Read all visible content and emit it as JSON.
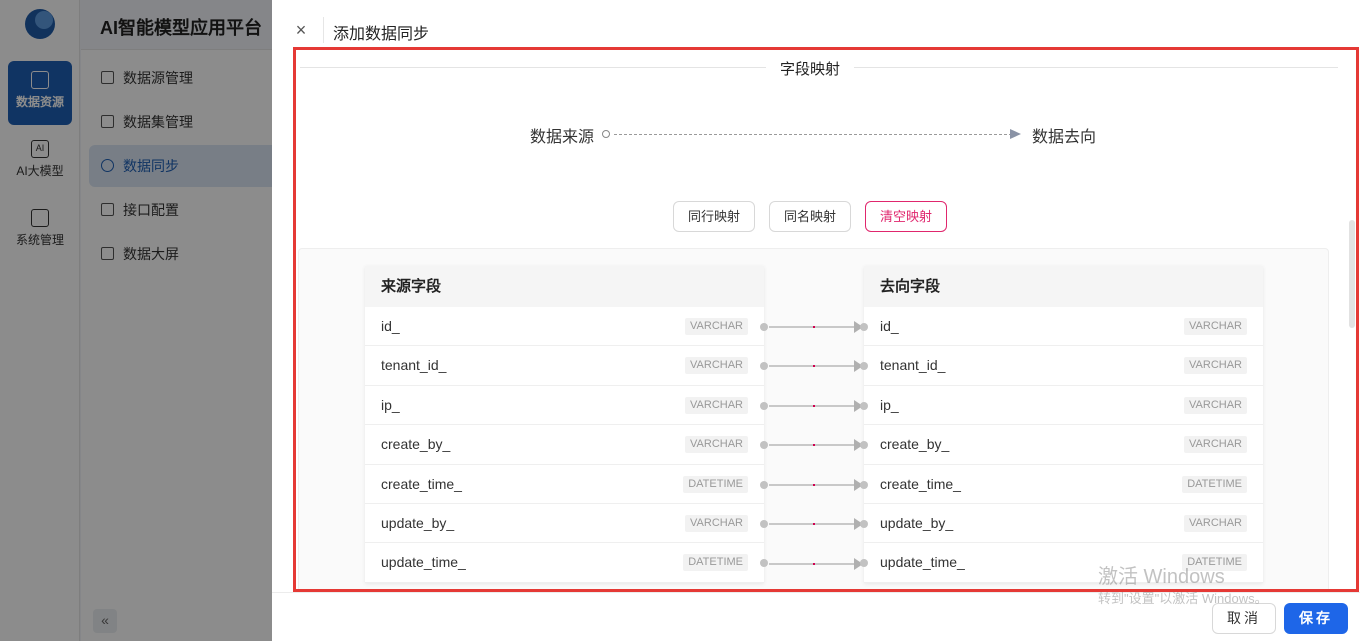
{
  "app": {
    "brand": "AI智能模型应用平台",
    "rail": [
      {
        "label": "数据资源",
        "active": true
      },
      {
        "label": "AI大模型",
        "active": false
      },
      {
        "label": "系统管理",
        "active": false
      }
    ],
    "subnav": [
      {
        "label": "数据源管理",
        "icon": "database-icon",
        "active": false
      },
      {
        "label": "数据集管理",
        "icon": "list-icon",
        "active": false
      },
      {
        "label": "数据同步",
        "icon": "sync-icon",
        "active": true
      },
      {
        "label": "接口配置",
        "icon": "plug-icon",
        "active": false
      },
      {
        "label": "数据大屏",
        "icon": "monitor-icon",
        "active": false
      }
    ],
    "collapse_label": "«"
  },
  "drawer": {
    "close_label": "×",
    "title": "添加数据同步",
    "section_title": "字段映射",
    "flow": {
      "source": "数据来源",
      "target": "数据去向"
    },
    "actions": {
      "row_map": "同行映射",
      "name_map": "同名映射",
      "clear_map": "清空映射"
    },
    "source_table": {
      "header": "来源字段",
      "rows": [
        {
          "name": "id_",
          "type": "VARCHAR"
        },
        {
          "name": "tenant_id_",
          "type": "VARCHAR"
        },
        {
          "name": "ip_",
          "type": "VARCHAR"
        },
        {
          "name": "create_by_",
          "type": "VARCHAR"
        },
        {
          "name": "create_time_",
          "type": "DATETIME"
        },
        {
          "name": "update_by_",
          "type": "VARCHAR"
        },
        {
          "name": "update_time_",
          "type": "DATETIME"
        }
      ]
    },
    "target_table": {
      "header": "去向字段",
      "rows": [
        {
          "name": "id_",
          "type": "VARCHAR"
        },
        {
          "name": "tenant_id_",
          "type": "VARCHAR"
        },
        {
          "name": "ip_",
          "type": "VARCHAR"
        },
        {
          "name": "create_by_",
          "type": "VARCHAR"
        },
        {
          "name": "create_time_",
          "type": "DATETIME"
        },
        {
          "name": "update_by_",
          "type": "VARCHAR"
        },
        {
          "name": "update_time_",
          "type": "DATETIME"
        }
      ]
    },
    "footer": {
      "cancel": "取消",
      "save": "保存"
    }
  },
  "watermark": {
    "title": "激活 Windows",
    "subtitle": "转到\"设置\"以激活 Windows。"
  },
  "colors": {
    "primary": "#1e5fb4",
    "save_button": "#1e66e8",
    "danger": "#e0266d",
    "highlight_border": "#e53935"
  }
}
